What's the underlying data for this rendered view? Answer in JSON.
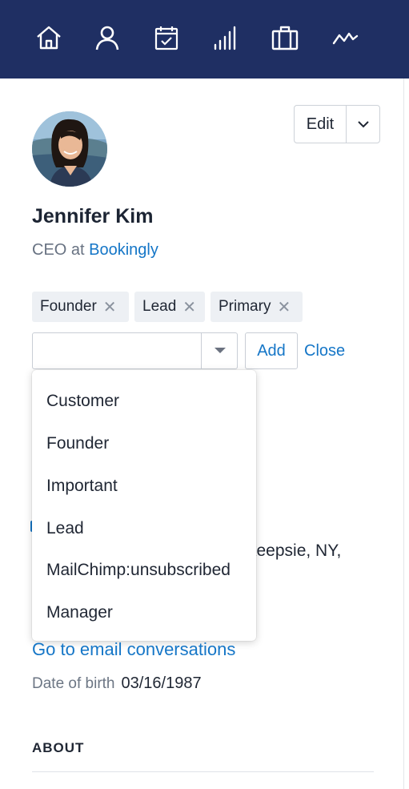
{
  "nav": {
    "icons": [
      "home-icon",
      "person-icon",
      "calendar-check-icon",
      "signal-bars-icon",
      "briefcase-icon",
      "activity-icon"
    ]
  },
  "profile": {
    "name": "Jennifer Kim",
    "role_prefix": "CEO at ",
    "company": "Bookingly"
  },
  "edit": {
    "label": "Edit"
  },
  "tags": [
    {
      "label": "Founder"
    },
    {
      "label": "Lead"
    },
    {
      "label": "Primary"
    }
  ],
  "tag_remove_glyph": "✕",
  "tag_editor": {
    "input_value": "",
    "add_label": "Add",
    "close_label": "Close"
  },
  "dropdown": {
    "options": [
      "Customer",
      "Founder",
      "Important",
      "Lead",
      "MailChimp:unsubscribed",
      "Manager"
    ]
  },
  "details": {
    "location_partial": "keepsie, NY,",
    "email_link": "Go to email conversations",
    "dob_label": "Date of birth",
    "dob_value": "03/16/1987"
  },
  "section": {
    "about": "ABOUT"
  },
  "colors": {
    "topbar": "#1f2f63",
    "link": "#1576c7",
    "tag_bg": "#edf0f4"
  }
}
